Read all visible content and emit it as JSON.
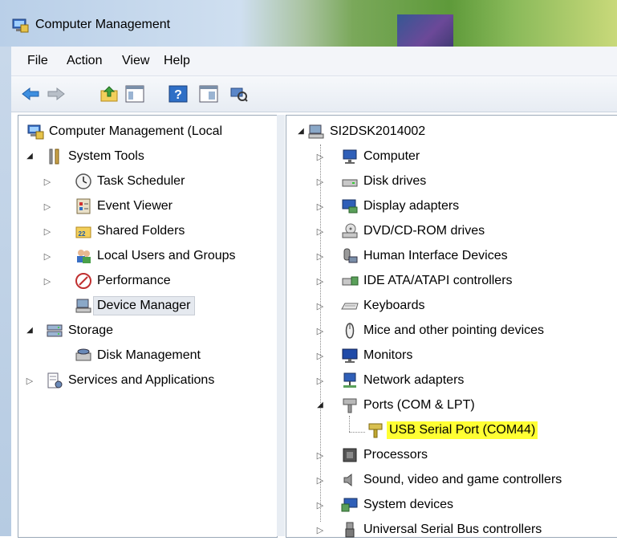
{
  "window": {
    "title": "Computer Management"
  },
  "menu": {
    "items": [
      "File",
      "Action",
      "View",
      "Help"
    ]
  },
  "toolbar": {
    "buttons": [
      "back-arrow-icon",
      "forward-arrow-icon",
      "up-folder-icon",
      "show-hide-tree-icon",
      "help-icon",
      "properties-icon",
      "scan-hardware-icon"
    ]
  },
  "left_tree": {
    "root": "Computer Management (Local",
    "items": [
      {
        "label": "System Tools",
        "icon": "tools-icon",
        "expander": "open"
      },
      {
        "label": "Task Scheduler",
        "icon": "clock-icon",
        "expander": "closed"
      },
      {
        "label": "Event Viewer",
        "icon": "event-viewer-icon",
        "expander": "closed"
      },
      {
        "label": "Shared Folders",
        "icon": "shared-folder-icon",
        "expander": "closed"
      },
      {
        "label": "Local Users and Groups",
        "icon": "users-icon",
        "expander": "closed"
      },
      {
        "label": "Performance",
        "icon": "performance-icon",
        "expander": "closed"
      },
      {
        "label": "Device Manager",
        "icon": "device-manager-icon",
        "expander": "none",
        "selected": true
      },
      {
        "label": "Storage",
        "icon": "storage-icon",
        "expander": "open"
      },
      {
        "label": "Disk Management",
        "icon": "disk-management-icon",
        "expander": "none"
      },
      {
        "label": "Services and Applications",
        "icon": "services-icon",
        "expander": "closed"
      }
    ]
  },
  "device_tree": {
    "root": "SI2DSK2014002",
    "categories": [
      {
        "label": "Computer",
        "icon": "computer-icon"
      },
      {
        "label": "Disk drives",
        "icon": "disk-drive-icon"
      },
      {
        "label": "Display adapters",
        "icon": "display-adapter-icon"
      },
      {
        "label": "DVD/CD-ROM drives",
        "icon": "dvd-drive-icon"
      },
      {
        "label": "Human Interface Devices",
        "icon": "hid-icon"
      },
      {
        "label": "IDE ATA/ATAPI controllers",
        "icon": "ide-controller-icon"
      },
      {
        "label": "Keyboards",
        "icon": "keyboard-icon"
      },
      {
        "label": "Mice and other pointing devices",
        "icon": "mouse-icon"
      },
      {
        "label": "Monitors",
        "icon": "monitor-icon"
      },
      {
        "label": "Network adapters",
        "icon": "network-adapter-icon"
      },
      {
        "label": "Ports (COM & LPT)",
        "icon": "port-icon"
      },
      {
        "label": "USB Serial Port (COM44)",
        "icon": "usb-serial-port-icon",
        "highlighted": true
      },
      {
        "label": "Processors",
        "icon": "processor-icon"
      },
      {
        "label": "Sound, video and game controllers",
        "icon": "sound-icon"
      },
      {
        "label": "System devices",
        "icon": "system-devices-icon"
      },
      {
        "label": "Universal Serial Bus controllers",
        "icon": "usb-controller-icon"
      }
    ]
  },
  "colors": {
    "highlight": "#ffff33",
    "selection": "#e5e9ef"
  }
}
